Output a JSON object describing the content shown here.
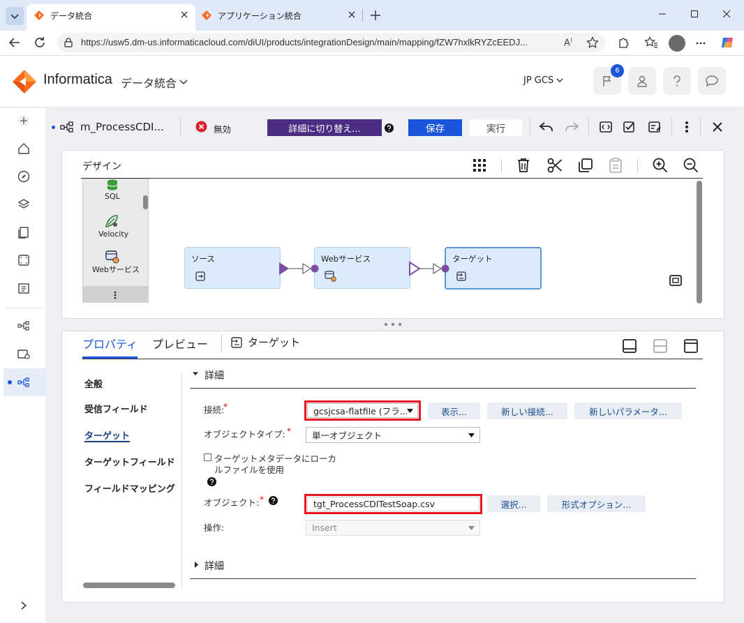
{
  "browser": {
    "tabs": [
      {
        "title": "データ統合"
      },
      {
        "title": "アプリケーション統合"
      }
    ],
    "url": "https://usw5.dm-us.informaticacloud.com/diUI/products/integrationDesign/main/mapping/fZW7hxlkRYZcEEDJ..."
  },
  "header": {
    "brand": "Informatica",
    "product": "データ統合",
    "org": "JP GCS",
    "notification_count": "6"
  },
  "mapping": {
    "name": "m_ProcessCDI...",
    "status": "無効",
    "switch_label": "詳細に切り替え...",
    "save_label": "保存",
    "run_label": "実行"
  },
  "design": {
    "title": "デザイン",
    "palette": [
      {
        "label": "SQL"
      },
      {
        "label": "Velocity"
      },
      {
        "label": "Webサービス"
      }
    ],
    "nodes": [
      {
        "label": "ソース"
      },
      {
        "label": "Webサービス"
      },
      {
        "label": "ターゲット"
      }
    ]
  },
  "properties": {
    "tabs": {
      "props": "プロパティ",
      "preview": "プレビュー",
      "target": "ターゲット"
    },
    "side": [
      "全般",
      "受信フィールド",
      "ターゲット",
      "ターゲットフィールド",
      "フィールドマッピング"
    ],
    "section1": "詳細",
    "section2": "詳細",
    "connection_label": "接続:",
    "connection_value": "gcsjcsa-flatfile (フラ...",
    "view_btn": "表示...",
    "new_conn_btn": "新しい接続...",
    "new_param_btn": "新しいパラメータ...",
    "objtype_label": "オブジェクトタイプ:",
    "objtype_value": "単一オブジェクト",
    "checkbox_label_1": "ターゲットメタデータにローカ",
    "checkbox_label_2": "ルファイルを使用",
    "object_label": "オブジェクト:",
    "object_value": "tgt_ProcessCDITestSoap.csv",
    "select_btn": "選択...",
    "format_btn": "形式オプション...",
    "operation_label": "操作:",
    "operation_value": "Insert"
  }
}
